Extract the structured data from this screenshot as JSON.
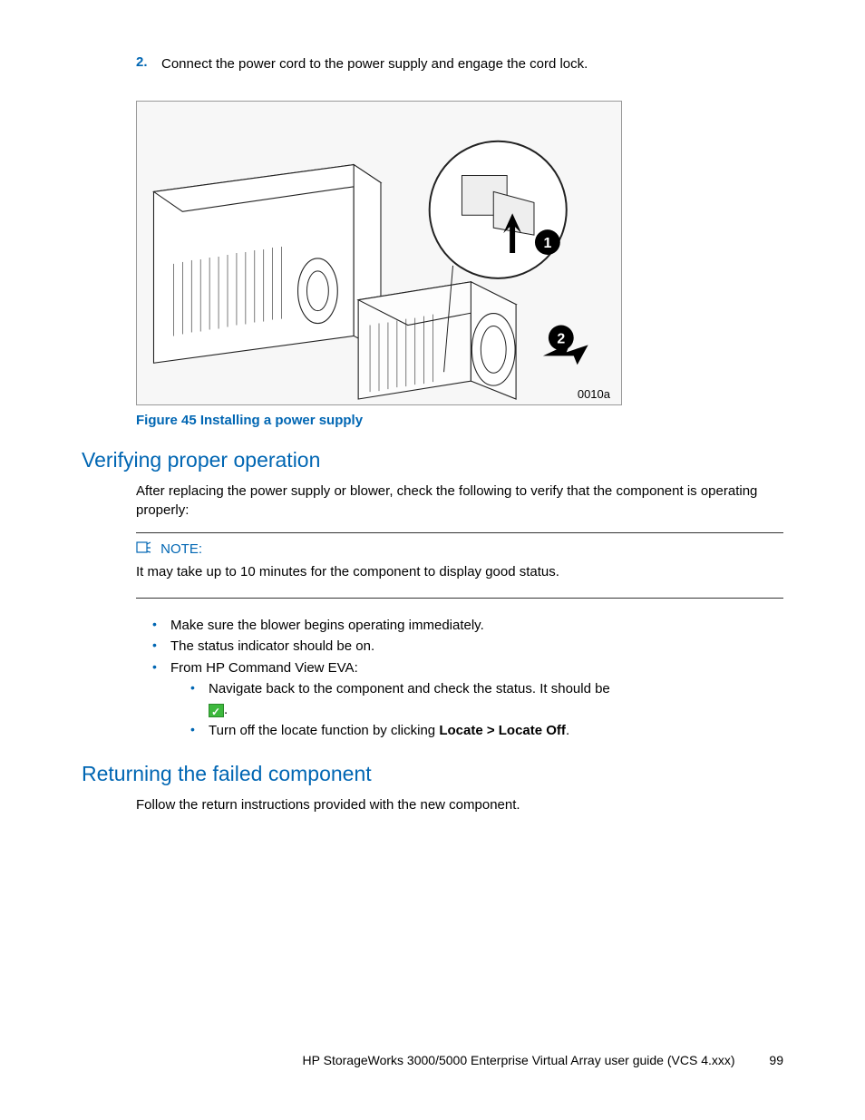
{
  "step2": {
    "number": "2.",
    "text": "Connect the power cord to the power supply and engage the cord lock."
  },
  "figure": {
    "id": "0010a",
    "caption": "Figure 45 Installing a power supply",
    "callout1": "1",
    "callout2": "2"
  },
  "section1": {
    "heading": "Verifying proper operation",
    "para": "After replacing the power supply or blower, check the following to verify that the component is operating properly:"
  },
  "note": {
    "label": "NOTE:",
    "text": "It may take up to 10 minutes for the component to display good status."
  },
  "bullets": {
    "b1": "Make sure the blower begins operating immediately.",
    "b2": "The status indicator should be on.",
    "b3": "From HP Command View EVA:",
    "sub1a": "Navigate back to the component and check the status.  It should be",
    "sub1b": ".",
    "sub2a": "Turn off the locate function by clicking ",
    "sub2b": "Locate > Locate Off",
    "sub2c": "."
  },
  "section2": {
    "heading": "Returning the failed component",
    "para": "Follow the return instructions provided with the new component."
  },
  "footer": {
    "text": "HP StorageWorks 3000/5000 Enterprise Virtual Array user guide (VCS 4.xxx)",
    "page": "99"
  }
}
